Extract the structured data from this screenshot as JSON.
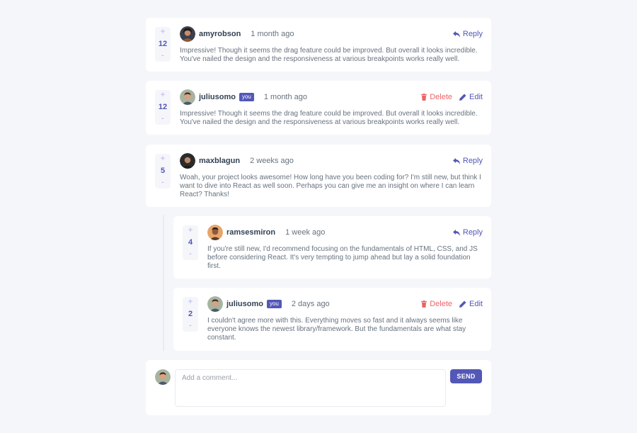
{
  "current_user": {
    "username": "juliusomo",
    "badge": "you"
  },
  "colors": {
    "primary": "#5357b6",
    "danger": "#ed6368",
    "heading": "#334253",
    "text": "#67727e",
    "vote_bg": "#f5f6fa"
  },
  "vote_labels": {
    "up": "+",
    "down": "-"
  },
  "action_labels": {
    "reply": "Reply",
    "delete": "Delete",
    "edit": "Edit"
  },
  "comments": [
    {
      "username": "amyrobson",
      "date": "1 month ago",
      "score": "12",
      "text": "Impressive! Though it seems the drag feature could be improved. But overall it looks incredible. You've nailed the design and the responsiveness at various breakpoints works really well."
    },
    {
      "username": "juliusomo",
      "date": "1 month ago",
      "score": "12",
      "text": "Impressive! Though it seems the drag feature could be improved. But overall it looks incredible. You've nailed the design and the responsiveness at various breakpoints works really well."
    },
    {
      "username": "maxblagun",
      "date": "2 weeks ago",
      "score": "5",
      "text": "Woah, your project looks awesome! How long have you been coding for? I'm still new, but think I want to dive into React as well soon. Perhaps you can give me an insight on where I can learn React? Thanks!"
    }
  ],
  "replies": [
    {
      "username": "ramsesmiron",
      "date": "1 week ago",
      "score": "4",
      "text": "If you're still new, I'd recommend focusing on the fundamentals of HTML, CSS, and JS before considering React. It's very tempting to jump ahead but lay a solid foundation first."
    },
    {
      "username": "juliusomo",
      "date": "2 days ago",
      "score": "2",
      "text": "I couldn't agree more with this. Everything moves so fast and it always seems like everyone knows the newest library/framework. But the fundamentals are what stay constant."
    }
  ],
  "composer": {
    "placeholder": "Add a comment...",
    "value": "",
    "send_label": "SEND"
  }
}
